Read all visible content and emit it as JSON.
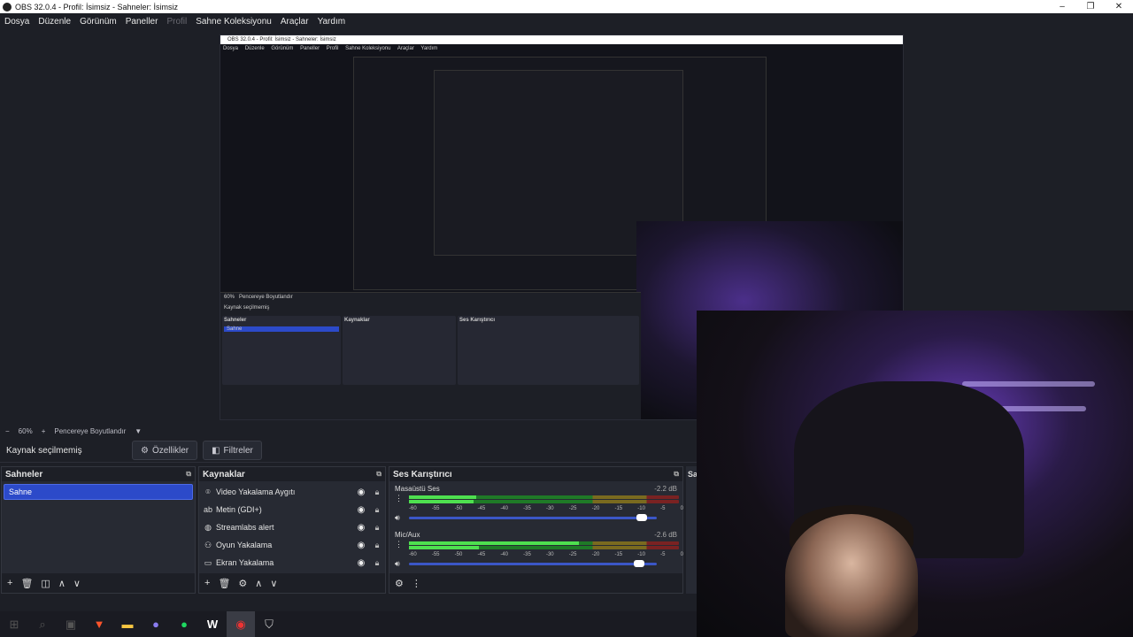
{
  "window": {
    "title": "OBS 32.0.4 - Profil: İsimsiz - Sahneler: İsimsiz",
    "minimize": "–",
    "maximize": "❐",
    "close": "✕"
  },
  "menu": {
    "items": [
      "Dosya",
      "Düzenle",
      "Görünüm",
      "Paneller",
      "Profil",
      "Sahne Koleksiyonu",
      "Araçlar",
      "Yardım"
    ]
  },
  "nested_preview": {
    "title": "OBS 32.0.4 - Profil: İsimsiz - Sahneler: İsimsiz",
    "menu": [
      "Dosya",
      "Düzenle",
      "Görünüm",
      "Paneller",
      "Profil",
      "Sahne Koleksiyonu",
      "Araçlar",
      "Yardım"
    ],
    "zoom": "60%",
    "zoom_mode": "Pencereye Boyutlandır",
    "no_selection": "Kaynak seçilmemiş",
    "scenes_title": "Sahneler",
    "sources_title": "Kaynaklar",
    "mixer_title": "Ses Karıştırıcı",
    "scene": "Sahne"
  },
  "zoombar": {
    "minus": "−",
    "zoom": "60%",
    "plus": "+",
    "mode": "Pencereye Boyutlandır",
    "dropdown": "▼"
  },
  "props": {
    "no_selection": "Kaynak seçilmemiş",
    "properties_label": "Özellikler",
    "filters_label": "Filtreler"
  },
  "scenes": {
    "title": "Sahneler",
    "items": [
      "Sahne"
    ]
  },
  "sources": {
    "title": "Kaynaklar",
    "items": [
      {
        "icon": "camera-icon",
        "glyph": "📷",
        "label": "Video Yakalama Aygıtı"
      },
      {
        "icon": "text-icon",
        "glyph": "ab",
        "label": "Metin (GDI+)"
      },
      {
        "icon": "browser-icon",
        "glyph": "🌐",
        "label": "Streamlabs alert"
      },
      {
        "icon": "gamepad-icon",
        "glyph": "🎮",
        "label": "Oyun Yakalama"
      },
      {
        "icon": "monitor-icon",
        "glyph": "▭",
        "label": "Ekran Yakalama"
      }
    ]
  },
  "mixer": {
    "title": "Ses Karıştırıcı",
    "ticks": [
      "-60",
      "-55",
      "-50",
      "-45",
      "-40",
      "-35",
      "-30",
      "-25",
      "-20",
      "-15",
      "-10",
      "-5",
      "0"
    ],
    "channels": [
      {
        "name": "Masaüstü Ses",
        "db": "-2.2 dB",
        "level_top": 0.25,
        "level_bot": 0.24,
        "volume": 0.94
      },
      {
        "name": "Mic/Aux",
        "db": "-2.6 dB",
        "level_top": 0.63,
        "level_bot": 0.26,
        "volume": 0.93
      }
    ]
  },
  "partial_dock": {
    "label": "Sa"
  },
  "taskbar": {
    "icons": [
      "windows-icon",
      "search-icon",
      "task-view-icon",
      "brave-icon",
      "folder-icon",
      "discord-icon",
      "spotify-icon",
      "wattpad-icon",
      "obs-icon",
      "shield-icon"
    ]
  },
  "colors": {
    "accent": "#2c4ac9",
    "background": "#1d1f26",
    "dock": "#272a33",
    "meter_green": "#4ee04f"
  }
}
